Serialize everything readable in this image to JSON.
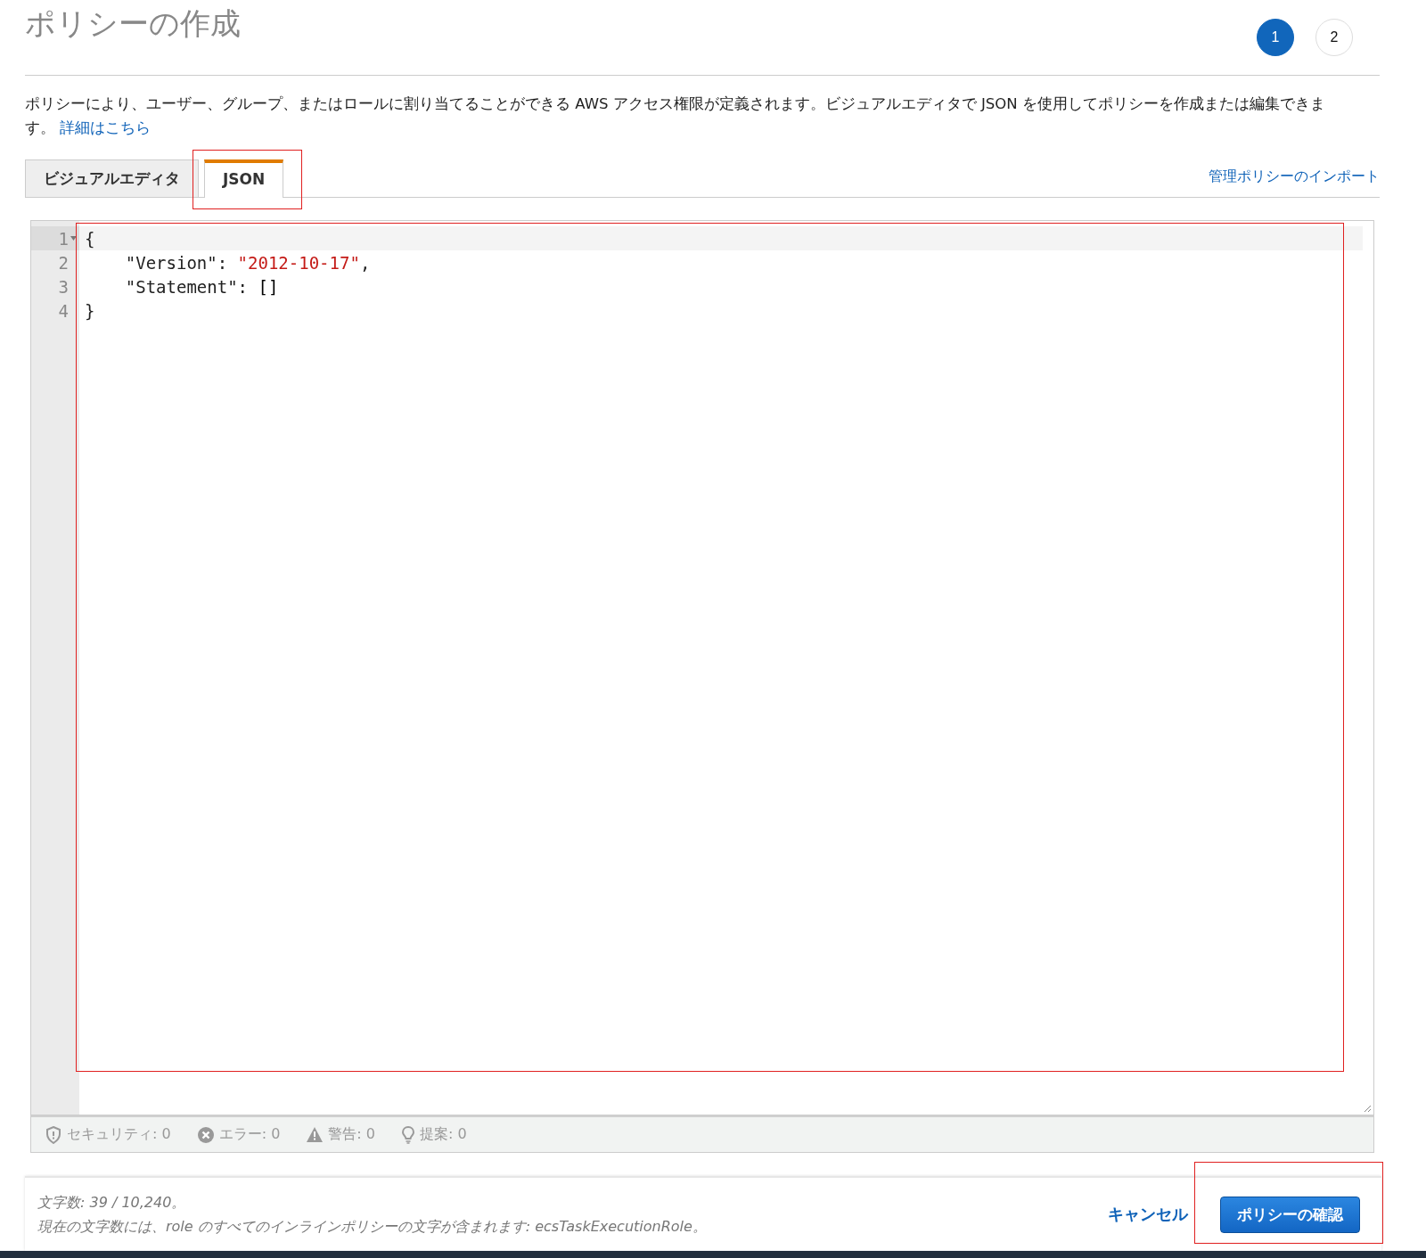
{
  "page": {
    "title": "ポリシーの作成"
  },
  "steps": [
    {
      "label": "1",
      "selected": true
    },
    {
      "label": "2",
      "selected": false
    }
  ],
  "description": {
    "text": "ポリシーにより、ユーザー、グループ、またはロールに割り当てることができる AWS アクセス権限が定義されます。ビジュアルエディタで JSON を使用してポリシーを作成または編集できます。",
    "link": "詳細はこちら"
  },
  "tabs": [
    {
      "label": "ビジュアルエディタ",
      "selected": false
    },
    {
      "label": "JSON",
      "selected": true
    }
  ],
  "import_link": "管理ポリシーのインポート",
  "editor": {
    "lines": [
      {
        "number": "1",
        "active": true,
        "foldable": true,
        "tokens": [
          {
            "text": "{",
            "kind": "punct"
          }
        ]
      },
      {
        "number": "2",
        "active": false,
        "foldable": false,
        "tokens": [
          {
            "text": "    \"Version\"",
            "kind": "key"
          },
          {
            "text": ": ",
            "kind": "punct"
          },
          {
            "text": "\"2012-10-17\"",
            "kind": "string"
          },
          {
            "text": ",",
            "kind": "punct"
          }
        ]
      },
      {
        "number": "3",
        "active": false,
        "foldable": false,
        "tokens": [
          {
            "text": "    \"Statement\"",
            "kind": "key"
          },
          {
            "text": ": ",
            "kind": "punct"
          },
          {
            "text": "[]",
            "kind": "bracket"
          }
        ]
      },
      {
        "number": "4",
        "active": false,
        "foldable": false,
        "tokens": [
          {
            "text": "}",
            "kind": "punct"
          }
        ]
      }
    ]
  },
  "status_bar": [
    {
      "kind": "security",
      "label": "セキュリティ: 0"
    },
    {
      "kind": "error",
      "label": "エラー: 0"
    },
    {
      "kind": "warning",
      "label": "警告: 0"
    },
    {
      "kind": "suggestion",
      "label": "提案: 0"
    }
  ],
  "footer": {
    "count": "文字数: 39 / 10,240。",
    "note": "現在の文字数には、role のすべてのインラインポリシーの文字が含まれます: ecsTaskExecutionRole。",
    "cancel": "キャンセル",
    "confirm": "ポリシーの確認"
  }
}
